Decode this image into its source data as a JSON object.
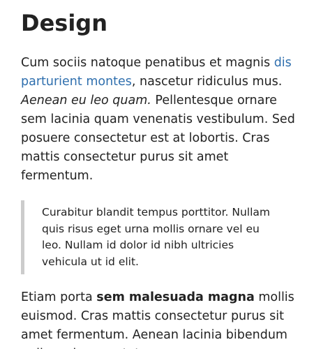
{
  "article": {
    "title": "Design",
    "paragraph1": {
      "before_link": "Cum sociis natoque penatibus et magnis ",
      "link_text": "dis parturient montes",
      "after_link": ", nascetur ridiculus mus. ",
      "emphasis": "Aenean eu leo quam.",
      "rest": " Pellentesque ornare sem lacinia quam venenatis vestibulum. Sed posuere consectetur est at lobortis. Cras mattis consectetur purus sit amet fermentum."
    },
    "blockquote": "Curabitur blandit tempus porttitor. Nullam quis risus eget urna mollis ornare vel eu leo. Nullam id dolor id nibh ultricies vehicula ut id elit.",
    "paragraph2": {
      "before_bold": "Etiam porta ",
      "bold": "sem malesuada magna",
      "rest": " mollis euismod. Cras mattis consectetur purus sit amet fermentum. Aenean lacinia bibendum nulla sed consectetur."
    }
  },
  "colors": {
    "text": "#222222",
    "link": "#2f6fae",
    "quote_border": "#cccccc"
  }
}
